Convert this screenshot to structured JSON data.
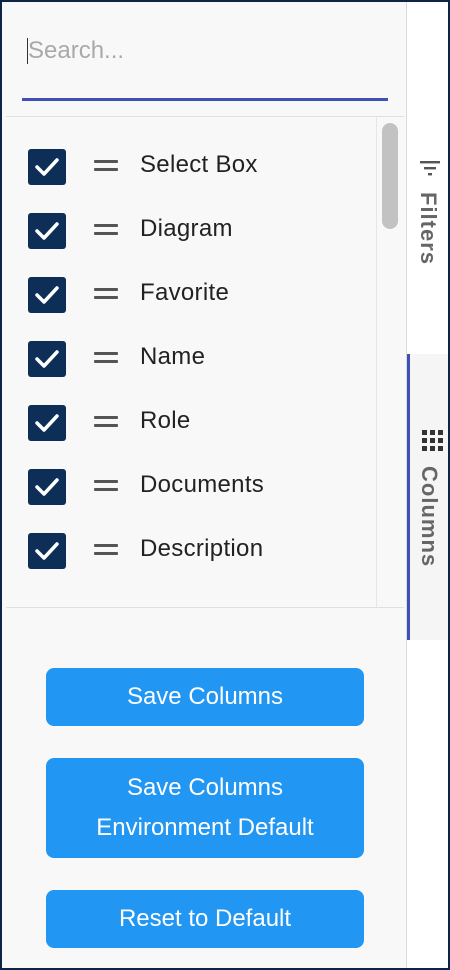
{
  "search": {
    "placeholder": "Search..."
  },
  "columns": [
    {
      "label": "Select Box",
      "checked": true
    },
    {
      "label": "Diagram",
      "checked": true
    },
    {
      "label": "Favorite",
      "checked": true
    },
    {
      "label": "Name",
      "checked": true
    },
    {
      "label": "Role",
      "checked": true
    },
    {
      "label": "Documents",
      "checked": true
    },
    {
      "label": "Description",
      "checked": true
    }
  ],
  "buttons": {
    "save_columns": "Save Columns",
    "save_env_line1": "Save Columns",
    "save_env_line2": "Environment Default",
    "reset": "Reset to Default"
  },
  "side_tabs": {
    "filters": "Filters",
    "columns": "Columns",
    "active": "columns"
  },
  "colors": {
    "accent": "#3f51b5",
    "button": "#2196f3",
    "checkbox": "#0d2f57"
  }
}
